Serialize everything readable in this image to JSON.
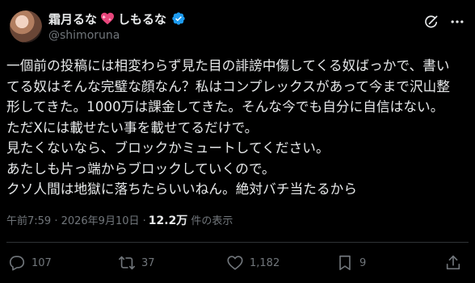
{
  "user": {
    "display_name_part1": "霜月るな",
    "display_name_part2": "しもるな",
    "handle": "@shimoruna"
  },
  "post": {
    "text": "一個前の投稿には相変わらず見た目の誹謗中傷してくる奴ばっかで、書い\nてる奴はそんな完璧な顔なん？私はコンプレックスがあって今まで沢山整\n形してきた。1000万は課金してきた。そんな今でも自分に自信はない。\nただXには載せたい事を載せてるだけで。\n見たくないなら、ブロックかミュートしてください。\nあたしも片っ端からブロックしていくので。\nクソ人間は地獄に落ちたらいいねん。絶対バチ当たるから"
  },
  "meta": {
    "timestamp": "午前7:59 · 2026年9月10日 · ",
    "views_count": "12.2万",
    "views_label": "件の表示"
  },
  "actions": {
    "replies": "107",
    "reposts": "37",
    "likes": "1,182",
    "bookmarks": "9"
  },
  "icons": {
    "heart": "sparkling-heart-icon",
    "verified": "verified-badge-icon",
    "grok": "grok-icon",
    "more": "more-icon",
    "reply": "reply-icon",
    "repost": "repost-icon",
    "like": "like-icon",
    "bookmark": "bookmark-icon",
    "share": "share-icon"
  },
  "colors": {
    "background": "#000000",
    "text": "#e7e9ea",
    "secondary": "#71767b",
    "verified": "#1d9bf0",
    "heart": "#e8467c"
  }
}
